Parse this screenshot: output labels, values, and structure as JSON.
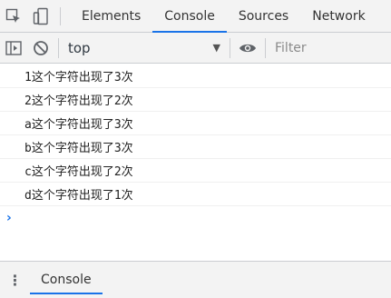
{
  "tabbar": {
    "tabs": [
      {
        "label": "Elements"
      },
      {
        "label": "Console"
      },
      {
        "label": "Sources"
      },
      {
        "label": "Network"
      }
    ],
    "active_tab": "Console"
  },
  "toolbar": {
    "context": "top",
    "filter_placeholder": "Filter"
  },
  "console": {
    "messages": [
      "1这个字符出现了3次",
      "2这个字符出现了2次",
      "a这个字符出现了3次",
      "b这个字符出现了3次",
      "c这个字符出现了2次",
      "d这个字符出现了1次"
    ],
    "prompt_symbol": "›"
  },
  "drawer": {
    "tab_label": "Console",
    "menu_glyph": "⋮"
  },
  "colors": {
    "accent": "#1a73e8",
    "toolbar_bg": "#f3f3f3",
    "border": "#cbcdd1"
  }
}
